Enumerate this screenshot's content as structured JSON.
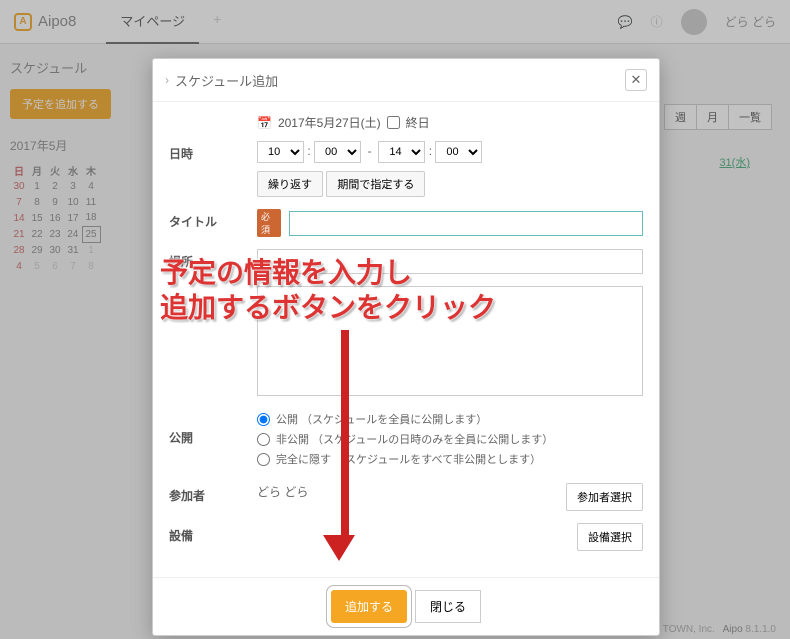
{
  "header": {
    "app_name": "Aipo8",
    "tab_active": "マイページ",
    "user_name": "どら どら"
  },
  "sidebar": {
    "title": "スケジュール",
    "add_btn": "予定を追加する",
    "month": "2017年5月",
    "dow": [
      "日",
      "月",
      "火",
      "水",
      "木"
    ],
    "weeks": [
      [
        "30",
        "1",
        "2",
        "3",
        "4"
      ],
      [
        "7",
        "8",
        "9",
        "10",
        "11"
      ],
      [
        "14",
        "15",
        "16",
        "17",
        "18"
      ],
      [
        "21",
        "22",
        "23",
        "24",
        "25"
      ],
      [
        "28",
        "29",
        "30",
        "31",
        "1"
      ],
      [
        "4",
        "5",
        "6",
        "7",
        "8"
      ]
    ]
  },
  "view_tabs": [
    "週",
    "月",
    "一覧"
  ],
  "day_header": "31(水)",
  "modal": {
    "title": "スケジュール追加",
    "date_text": "2017年5月27日(土)",
    "allday": "終日",
    "labels": {
      "datetime": "日時",
      "title": "タイトル",
      "location": "場所",
      "publish": "公開",
      "members": "参加者",
      "facility": "設備"
    },
    "required": "必須",
    "time": {
      "sh": "10",
      "sm": "00",
      "eh": "14",
      "em": "00"
    },
    "repeat_btn": "繰り返す",
    "range_btn": "期間で指定する",
    "publish_options": [
      "公開 （スケジュールを全員に公開します）",
      "非公開 （スケジュールの日時のみを全員に公開します）",
      "完全に隠す （スケジュールをすべて非公開とします）"
    ],
    "member_value": "どら どら",
    "member_btn": "参加者選択",
    "facility_btn": "設備選択",
    "submit": "追加する",
    "cancel": "閉じる"
  },
  "annotation": {
    "line1": "予定の情報を入力し",
    "line2": "追加するボタンをクリック"
  },
  "footer": {
    "copyright": "© TOWN, Inc.",
    "link": "Aipo",
    "ver": "8.1.1.0"
  }
}
